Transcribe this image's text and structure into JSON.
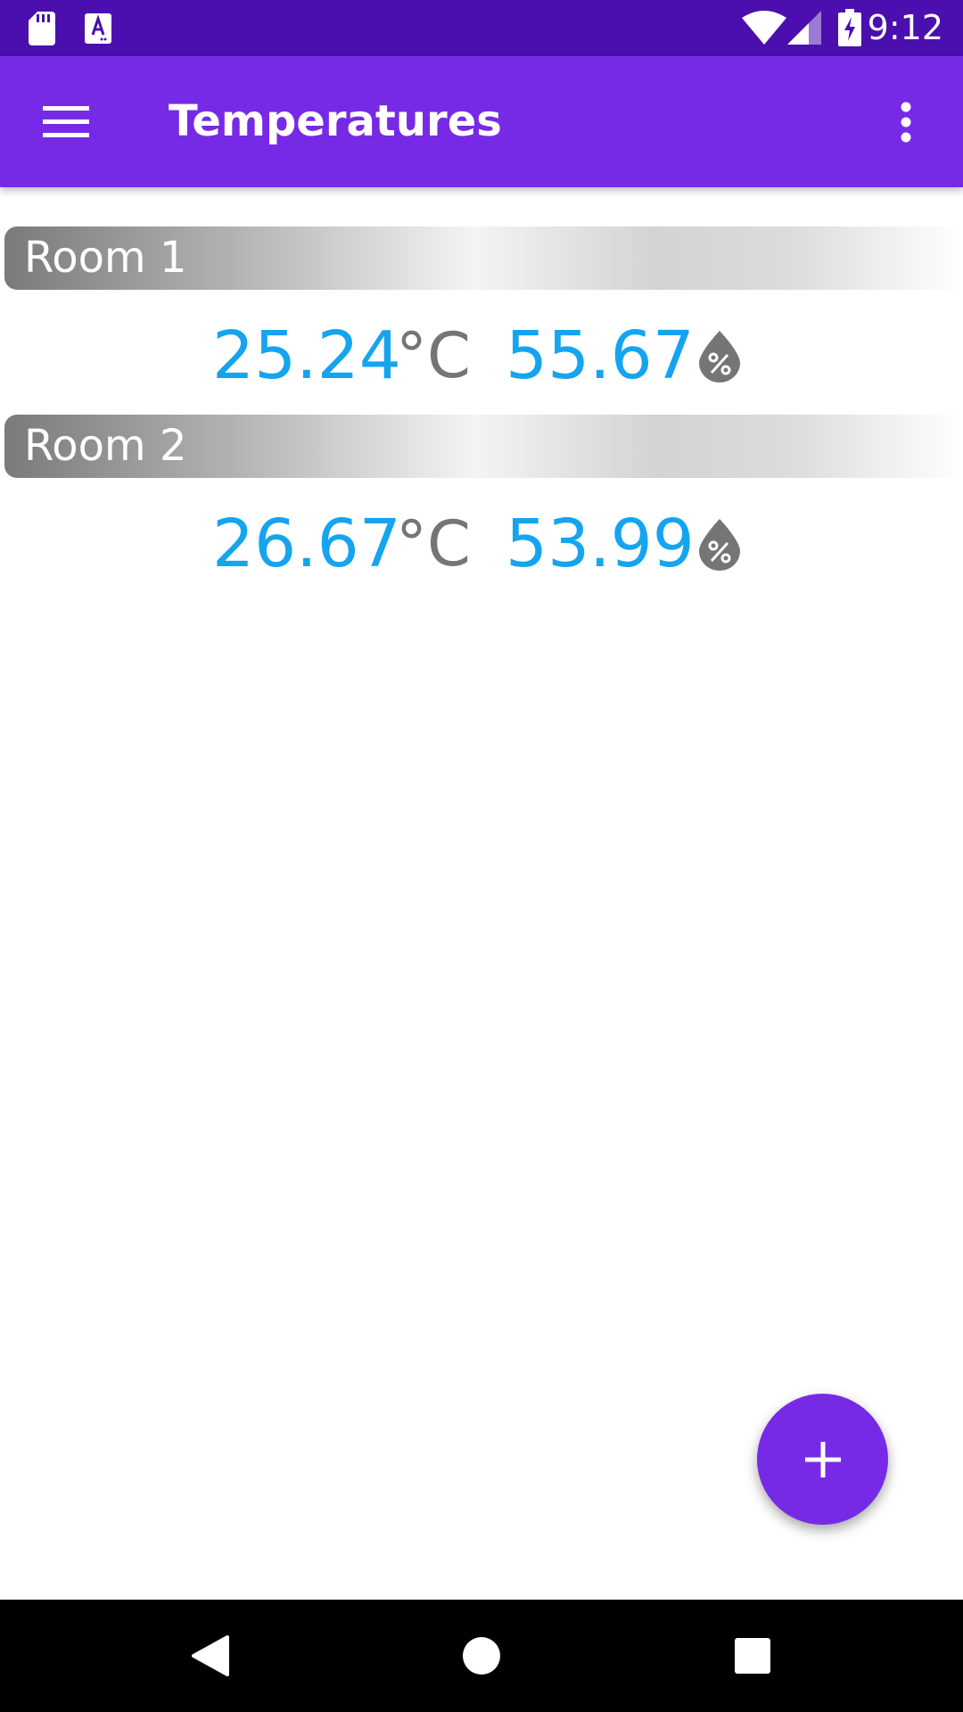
{
  "status_bar": {
    "time": "9:12",
    "icons": [
      "sd-card-icon",
      "font-app-icon",
      "wifi-icon",
      "cellular-signal-icon",
      "battery-charging-icon"
    ]
  },
  "app_bar": {
    "title": "Temperatures",
    "menu_icon": "hamburger-menu-icon",
    "overflow_icon": "more-vertical-icon"
  },
  "rooms": [
    {
      "name": "Room 1",
      "temperature": "25.24",
      "temperature_unit": "°C",
      "humidity": "55.67",
      "humidity_icon": "humidity-percent-drop-icon"
    },
    {
      "name": "Room 2",
      "temperature": "26.67",
      "temperature_unit": "°C",
      "humidity": "53.99",
      "humidity_icon": "humidity-percent-drop-icon"
    }
  ],
  "fab": {
    "icon": "plus-icon"
  },
  "nav_bar": {
    "icons": [
      "back-icon",
      "home-icon",
      "recents-icon"
    ]
  },
  "colors": {
    "status_bar": "#4a0fae",
    "app_bar": "#772ae6",
    "fab": "#772ae6",
    "value_text": "#15a4ef",
    "unit_text": "#757575"
  }
}
